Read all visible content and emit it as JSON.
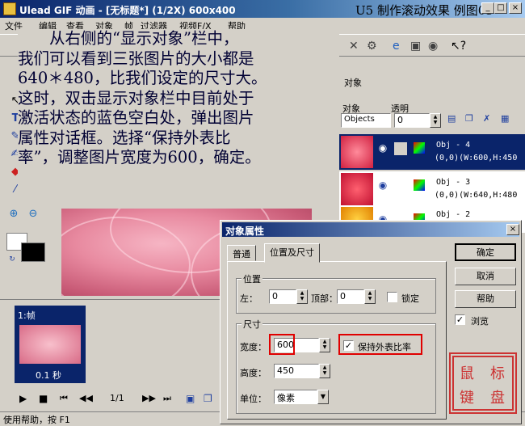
{
  "window": {
    "title": "Ulead GIF 动画 - [无标题*] (1/2X) 600x400",
    "lesson": "U5 制作滚动效果 例图05"
  },
  "menu": [
    "文件",
    "编辑",
    "查看",
    "对象",
    "帧",
    "过滤器",
    "视频F/X",
    "帮助"
  ],
  "overlay": {
    "lines": [
      "　　从右侧的“显示对象”栏中，",
      "我们可以看到三张图片的大小都是",
      "640＊480，比我们设定的尺寸大。",
      "这时，双击显示对象栏中目前处于",
      "激活状态的蓝色空白处，弹出图片",
      "属性对话框。选择“保持外表比",
      "率”，调整图片宽度为600，确定。"
    ]
  },
  "object_panel": {
    "header": "对象",
    "col_object": "对象",
    "col_opacity": "透明",
    "object_select": "Objects",
    "opacity_value": "0",
    "rows": [
      {
        "name": "Obj - 4",
        "info": "(0,0)(W:600,H:450"
      },
      {
        "name": "Obj - 3",
        "info": "(0,0)(W:640,H:480"
      },
      {
        "name": "Obj - 2",
        "info": ""
      }
    ]
  },
  "frame_panel": {
    "frame_label": "1:帧",
    "frame_time": "0.1 秒",
    "counter": "1/1"
  },
  "statusbar": {
    "text": "使用帮助，按 F1"
  },
  "dialog": {
    "title": "对象属性",
    "tabs": [
      "普通",
      "位置及尺寸"
    ],
    "position_group": "位置",
    "left_label": "左：",
    "left_value": "0",
    "top_label": "顶部：",
    "top_value": "0",
    "lock_label": "锁定",
    "size_group": "尺寸",
    "width_label": "宽度：",
    "width_value": "600",
    "keep_ratio_label": "保持外表比率",
    "height_label": "高度：",
    "height_value": "450",
    "unit_label": "单位：",
    "unit_value": "像素",
    "ok": "确定",
    "cancel": "取消",
    "help": "帮助",
    "browse": "浏览"
  },
  "seal": {
    "text": "鼠标键盘"
  },
  "colors": {
    "accent": "#0a246a",
    "highlight": "#e00000",
    "seal": "#cc3333"
  }
}
